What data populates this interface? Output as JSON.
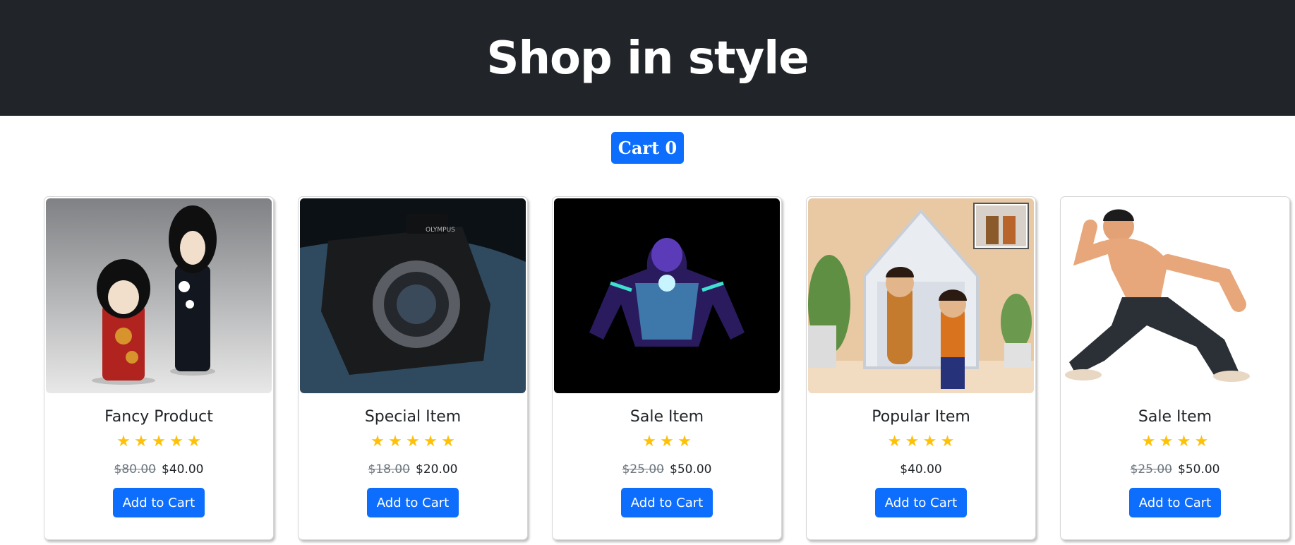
{
  "header": {
    "title": "Shop in style"
  },
  "cart": {
    "label": "Cart 0"
  },
  "products": [
    {
      "title": "Fancy Product",
      "stars": 5,
      "old_price": "$80.00",
      "price": "$40.00",
      "button": "Add to Cart",
      "image": "kokeshi-dolls-image"
    },
    {
      "title": "Special Item",
      "stars": 5,
      "old_price": "$18.00",
      "price": "$20.00",
      "button": "Add to Cart",
      "image": "camera-image"
    },
    {
      "title": "Sale Item",
      "stars": 3,
      "old_price": "$25.00",
      "price": "$50.00",
      "button": "Add to Cart",
      "image": "armored-hero-image"
    },
    {
      "title": "Popular Item",
      "stars": 4,
      "old_price": "",
      "price": "$40.00",
      "button": "Add to Cart",
      "image": "peg-dolls-house-image"
    },
    {
      "title": "Sale Item",
      "stars": 4,
      "old_price": "$25.00",
      "price": "$50.00",
      "button": "Add to Cart",
      "image": "action-figure-image"
    }
  ],
  "colors": {
    "header_bg": "#212529",
    "primary": "#0d6efd",
    "star": "#ffc107"
  }
}
